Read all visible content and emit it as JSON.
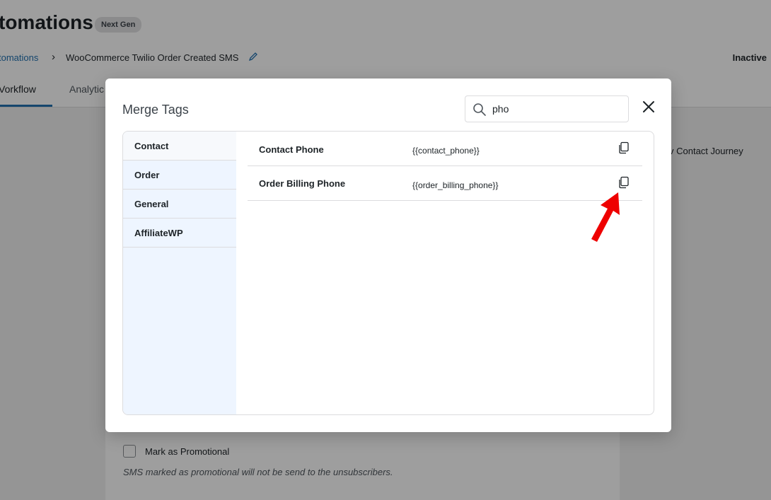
{
  "background": {
    "page_title": "tomations",
    "badge": "Next Gen",
    "breadcrumb_link": "tomations",
    "breadcrumb_current": "WooCommerce Twilio Order Created SMS",
    "status": "Inactive",
    "tabs": [
      {
        "label": "Vorkflow"
      },
      {
        "label": "Analytic"
      }
    ],
    "journey_link": "v Contact Journey",
    "checkbox_label": "Mark as Promotional",
    "help_text": "SMS marked as promotional will not be send to the unsubscribers."
  },
  "modal": {
    "title": "Merge Tags",
    "search_value": "pho",
    "search_icon": "search-icon",
    "close_icon": "close-icon",
    "categories": [
      {
        "label": "Contact"
      },
      {
        "label": "Order"
      },
      {
        "label": "General"
      },
      {
        "label": "AffiliateWP"
      }
    ],
    "results": [
      {
        "label": "Contact Phone",
        "tag": "{{contact_phone}}",
        "icon": "copy-icon"
      },
      {
        "label": "Order Billing Phone",
        "tag": "{{order_billing_phone}}",
        "icon": "copy-icon"
      }
    ]
  },
  "annotation": {
    "icon": "red-arrow-icon",
    "color": "#ee0000"
  }
}
